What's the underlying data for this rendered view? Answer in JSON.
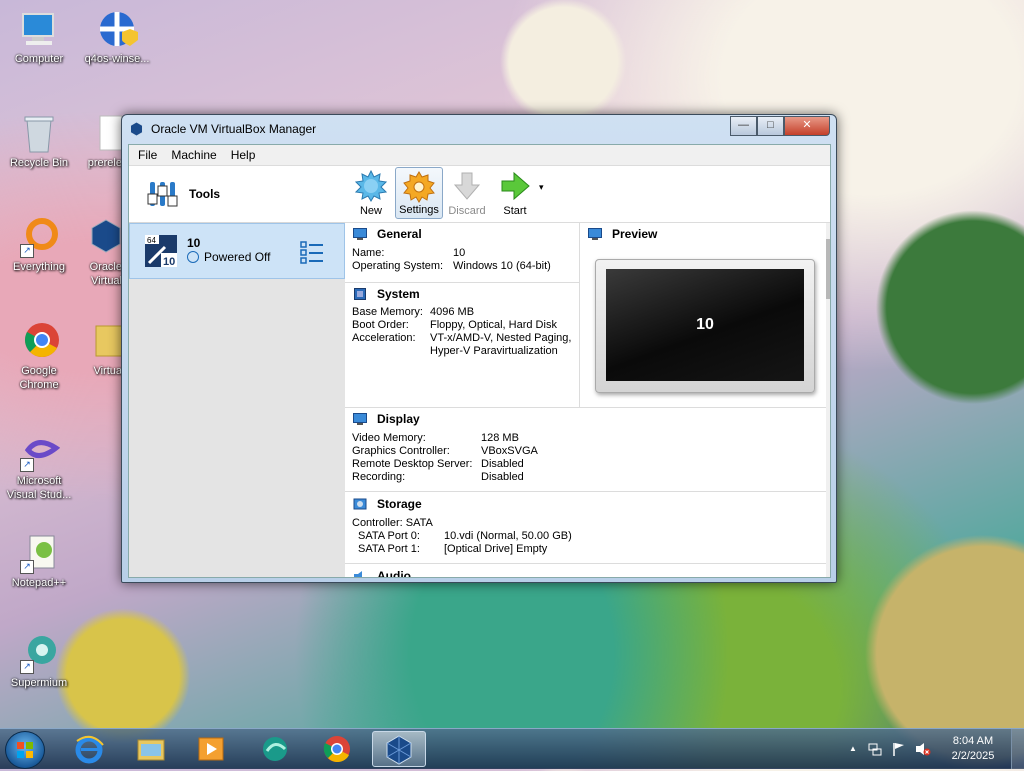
{
  "desktop": {
    "icons": [
      {
        "label": "Computer"
      },
      {
        "label": "q4os-winse..."
      },
      {
        "label": "Recycle Bin"
      },
      {
        "label": "prerele"
      },
      {
        "label": "Everything"
      },
      {
        "label": "Oracle Virtual"
      },
      {
        "label": "Google Chrome"
      },
      {
        "label": "Virtua"
      },
      {
        "label": "Microsoft Visual Stud..."
      },
      {
        "label": "Notepad++"
      },
      {
        "label": "Supermium"
      }
    ]
  },
  "window": {
    "title": "Oracle VM VirtualBox Manager",
    "controls": {
      "minimize": "—",
      "maximize": "□",
      "close": "✕"
    },
    "menu": [
      "File",
      "Machine",
      "Help"
    ]
  },
  "left_pane": {
    "tools_label": "Tools",
    "vm": {
      "name": "10",
      "state": "Powered Off",
      "os_badge_top": "64",
      "os_badge": "10"
    }
  },
  "toolbar": {
    "buttons": [
      {
        "label": "New",
        "icon": "new-icon"
      },
      {
        "label": "Settings",
        "icon": "gear-icon"
      },
      {
        "label": "Discard",
        "icon": "discard-arrow-icon"
      },
      {
        "label": "Start",
        "icon": "start-arrow-icon"
      }
    ],
    "start_dropdown": "▾"
  },
  "details": {
    "general": {
      "title": "General",
      "rows": [
        {
          "k": "Name:",
          "v": "10"
        },
        {
          "k": "Operating System:",
          "v": "Windows 10 (64-bit)"
        }
      ]
    },
    "system": {
      "title": "System",
      "rows": [
        {
          "k": "Base Memory:",
          "v": "4096 MB"
        },
        {
          "k": "Boot Order:",
          "v": "Floppy, Optical, Hard Disk"
        },
        {
          "k": "Acceleration:",
          "v": "VT-x/AMD-V, Nested Paging,"
        },
        {
          "k": "",
          "v": "Hyper-V Paravirtualization"
        }
      ]
    },
    "preview": {
      "title": "Preview",
      "screen_text": "10"
    },
    "display": {
      "title": "Display",
      "rows": [
        {
          "k": "Video Memory:",
          "v": "128 MB"
        },
        {
          "k": "Graphics Controller:",
          "v": "VBoxSVGA"
        },
        {
          "k": "Remote Desktop Server:",
          "v": "Disabled"
        },
        {
          "k": "Recording:",
          "v": "Disabled"
        }
      ]
    },
    "storage": {
      "title": "Storage",
      "controller": "Controller: SATA",
      "rows": [
        {
          "k": "SATA Port 0:",
          "v": "10.vdi (Normal, 50.00 GB)"
        },
        {
          "k": "SATA Port 1:",
          "v": "[Optical Drive] Empty"
        }
      ]
    },
    "audio": {
      "title": "Audio"
    }
  },
  "taskbar": {
    "items": [
      "internet-explorer-icon",
      "file-explorer-icon",
      "media-player-icon",
      "edge-icon",
      "chrome-icon",
      "virtualbox-icon"
    ],
    "tray": {
      "time": "8:04 AM",
      "date": "2/2/2025",
      "show_hidden": "▲"
    }
  },
  "colors": {
    "selection": "#cde3f7",
    "accent": "#1a6ab8"
  }
}
